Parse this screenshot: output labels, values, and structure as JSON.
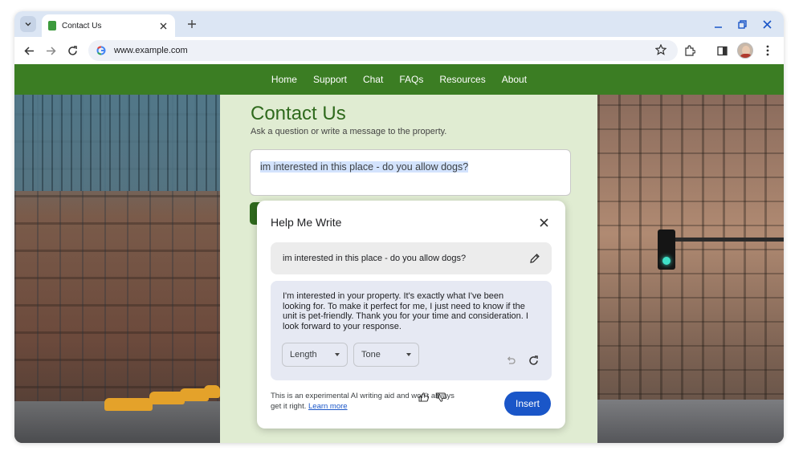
{
  "browser": {
    "tab": {
      "title": "Contact Us"
    },
    "address_bar": {
      "url": "www.example.com"
    }
  },
  "site": {
    "nav": [
      "Home",
      "Support",
      "Chat",
      "FAQs",
      "Resources",
      "About"
    ],
    "title": "Contact Us",
    "subtitle": "Ask a question or write a message to the property.",
    "message": "im interested in this place - do you allow dogs?"
  },
  "help_me_write": {
    "title": "Help Me Write",
    "prompt": "im interested in this place - do you allow dogs?",
    "result": "I'm interested in your property. It's exactly what I've been looking for. To make it perfect for me, I just need to know if the unit is pet-friendly. Thank you for your time and consideration. I look forward to your response.",
    "length_label": "Length",
    "tone_label": "Tone",
    "disclaimer": "This is an experimental AI writing aid and won't always get it right.",
    "learn_more": "Learn more",
    "insert_label": "Insert"
  },
  "colors": {
    "nav_green": "#3b7d23",
    "title_green": "#2f6a1d",
    "content_bg": "#e0ecd2",
    "insert_blue": "#1a56c8"
  }
}
